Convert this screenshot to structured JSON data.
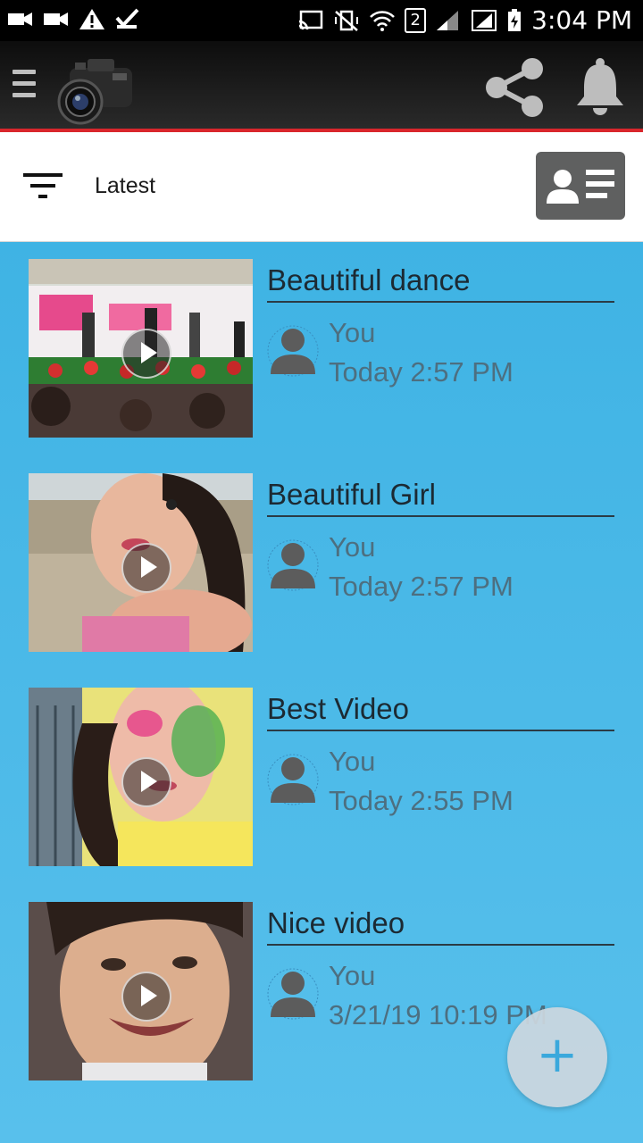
{
  "status_bar": {
    "time": "3:04 PM",
    "sim_badge": "2",
    "icons": [
      "video-camera-icon",
      "video-camera-icon",
      "warning-icon",
      "check-flag-icon",
      "cast-icon",
      "vibrate-mute-icon",
      "wifi-icon",
      "signal-icon",
      "signal-box-icon",
      "battery-charging-icon"
    ]
  },
  "app_bar": {
    "menu_icon": "hamburger-menu-icon",
    "logo_icon": "camera-logo-icon",
    "share_icon": "share-icon",
    "notification_icon": "bell-icon",
    "accent_color": "#d9262c"
  },
  "filter_bar": {
    "filter_icon": "filter-icon",
    "label": "Latest",
    "profile_icon": "contact-card-icon"
  },
  "feed": {
    "items": [
      {
        "title": "Beautiful dance",
        "author": "You",
        "time": "Today 2:57 PM",
        "thumb": "dance-stage-thumbnail"
      },
      {
        "title": "Beautiful Girl",
        "author": "You",
        "time": "Today 2:57 PM",
        "thumb": "beach-girl-thumbnail"
      },
      {
        "title": "Best Video",
        "author": "You",
        "time": "Today 2:55 PM",
        "thumb": "holi-colors-thumbnail"
      },
      {
        "title": "Nice video",
        "author": "You",
        "time": "3/21/19 10:19 PM",
        "thumb": "smiling-face-thumbnail"
      }
    ]
  },
  "fab": {
    "label": "+"
  }
}
